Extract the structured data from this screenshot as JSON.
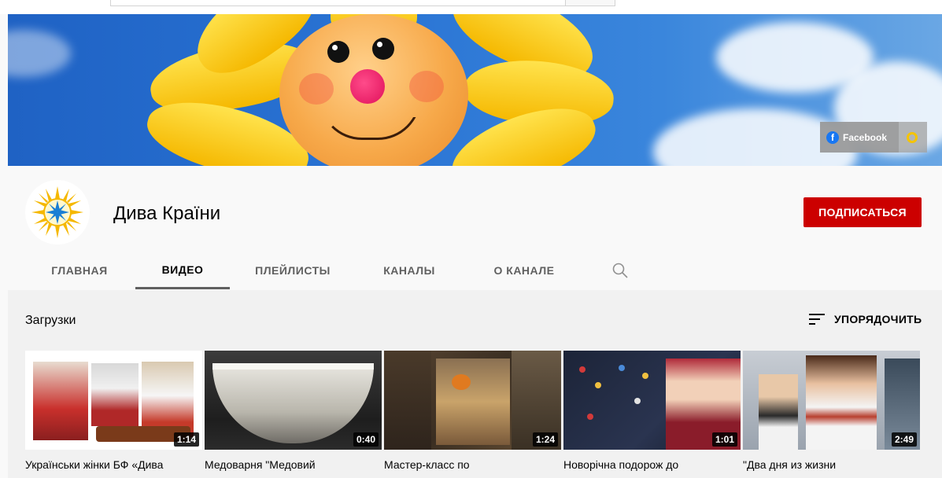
{
  "channel": {
    "name": "Дива Країни",
    "subscribe_label": "ПОДПИСАТЬСЯ"
  },
  "banner": {
    "social_link_label": "Facebook"
  },
  "tabs": [
    {
      "label": "ГЛАВНАЯ",
      "active": false
    },
    {
      "label": "ВИДЕО",
      "active": true
    },
    {
      "label": "ПЛЕЙЛИСТЫ",
      "active": false
    },
    {
      "label": "КАНАЛЫ",
      "active": false
    },
    {
      "label": "О КАНАЛЕ",
      "active": false
    }
  ],
  "section": {
    "title": "Загрузки",
    "sort_label": "УПОРЯДОЧИТЬ"
  },
  "videos": [
    {
      "title": "Українськи жінки БФ «Дива",
      "duration": "1:14"
    },
    {
      "title": "Медоварня \"Медовий",
      "duration": "0:40"
    },
    {
      "title": "Мастер-класс по",
      "duration": "1:24"
    },
    {
      "title": "Новорічна подорож до",
      "duration": "1:01"
    },
    {
      "title": "\"Два дня из жизни",
      "duration": "2:49"
    }
  ],
  "colors": {
    "subscribe_red": "#cc0000",
    "page_bg": "#f9f9f9",
    "content_bg": "#f1f1f1",
    "tab_inactive": "#606060",
    "facebook_blue": "#1877f2"
  }
}
